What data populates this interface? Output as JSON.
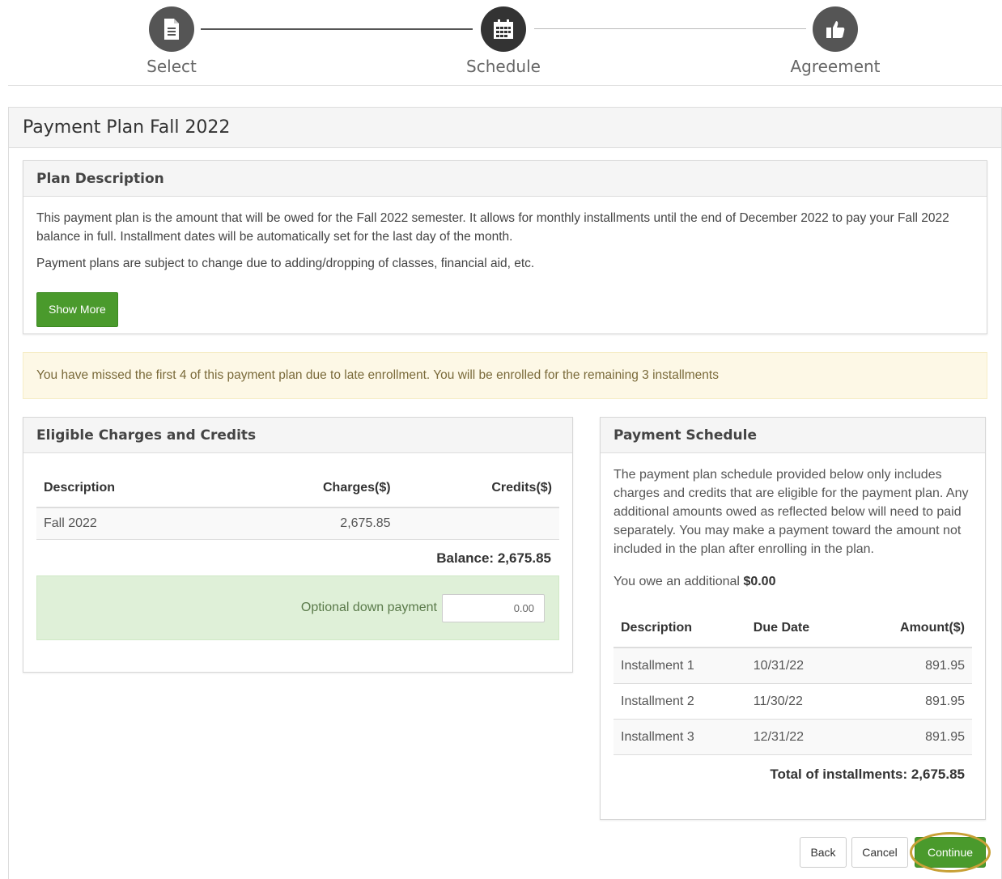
{
  "stepper": {
    "steps": [
      {
        "label": "Select",
        "icon": "document-icon"
      },
      {
        "label": "Schedule",
        "icon": "calendar-icon"
      },
      {
        "label": "Agreement",
        "icon": "thumbs-up-icon"
      }
    ]
  },
  "page": {
    "title": "Payment Plan Fall 2022"
  },
  "plan_description": {
    "heading": "Plan Description",
    "para1": "This payment plan is the amount that will be owed for the Fall 2022 semester. It allows for monthly installments until the end of December 2022 to pay your Fall 2022 balance in full. Installment dates will be automatically set for the last day of the month.",
    "para2": "Payment plans are subject to change due to adding/dropping of classes, financial aid, etc.",
    "show_more_label": "Show More"
  },
  "alert": {
    "text": "You have missed the first 4 of this payment plan due to late enrollment. You will be enrolled for the remaining 3 installments"
  },
  "eligible": {
    "heading": "Eligible Charges and Credits",
    "columns": [
      "Description",
      "Charges($)",
      "Credits($)"
    ],
    "rows": [
      {
        "description": "Fall 2022",
        "charges": "2,675.85",
        "credits": ""
      }
    ],
    "balance": "Balance: 2,675.85",
    "down_payment_label": "Optional down payment",
    "down_payment_value": "0.00"
  },
  "schedule": {
    "heading": "Payment Schedule",
    "intro": "The payment plan schedule provided below only includes charges and credits that are eligible for the payment plan. Any additional amounts owed as reflected below will need to paid separately. You may make a payment toward the amount not included in the plan after enrolling in the plan.",
    "owe_prefix": "You owe an additional",
    "owe_amount": "$0.00",
    "columns": [
      "Description",
      "Due Date",
      "Amount($)"
    ],
    "rows": [
      {
        "description": "Installment 1",
        "due": "10/31/22",
        "amount": "891.95"
      },
      {
        "description": "Installment 2",
        "due": "11/30/22",
        "amount": "891.95"
      },
      {
        "description": "Installment 3",
        "due": "12/31/22",
        "amount": "891.95"
      }
    ],
    "total": "Total of installments: 2,675.85"
  },
  "actions": {
    "back": "Back",
    "cancel": "Cancel",
    "continue": "Continue"
  },
  "colors": {
    "accent": "#4a9a2c",
    "highlight_ring": "#c8a036"
  }
}
